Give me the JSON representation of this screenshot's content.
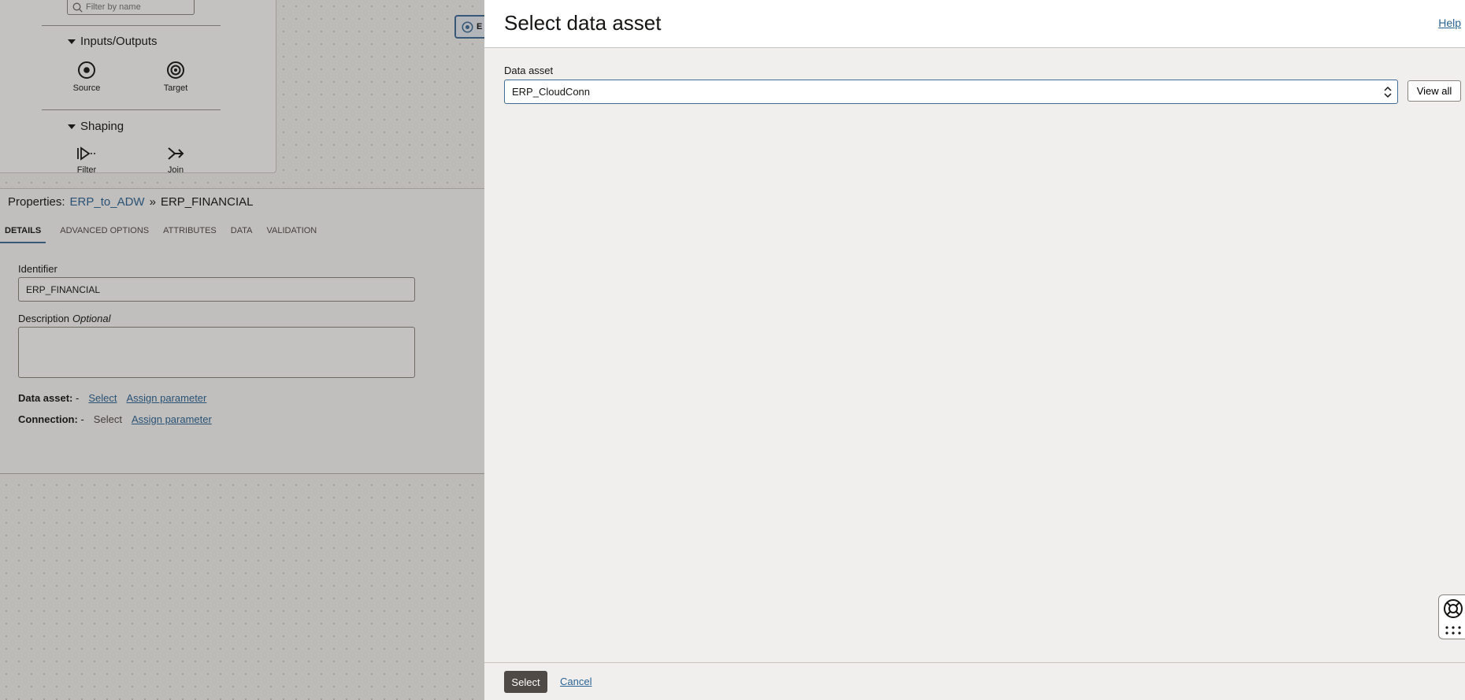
{
  "palette": {
    "filter_placeholder": "Filter by name",
    "sections": [
      {
        "label": "Inputs/Outputs",
        "items": [
          "Source",
          "Target"
        ]
      },
      {
        "label": "Shaping",
        "items": [
          "Filter",
          "Join"
        ]
      }
    ]
  },
  "canvas": {
    "node_label": "E"
  },
  "properties": {
    "prefix": "Properties:",
    "link": "ERP_to_ADW",
    "separator": "»",
    "current": "ERP_FINANCIAL",
    "tabs": [
      "DETAILS",
      "ADVANCED OPTIONS",
      "ATTRIBUTES",
      "DATA",
      "VALIDATION"
    ],
    "identifier_label": "Identifier",
    "identifier_value": "ERP_FINANCIAL",
    "description_label": "Description",
    "description_optional": "Optional",
    "data_asset_label": "Data asset:",
    "data_asset_value": "-",
    "connection_label": "Connection:",
    "connection_value": "-",
    "select_link": "Select",
    "select_text": "Select",
    "assign_parameter": "Assign parameter"
  },
  "drawer": {
    "title": "Select data asset",
    "help": "Help",
    "field_label": "Data asset",
    "selected_value": "ERP_CloudConn",
    "view_all": "View all",
    "select_button": "Select",
    "cancel": "Cancel"
  },
  "colors": {
    "accent": "#3f6c9a",
    "link": "#2a6496",
    "primary_button": "#4f4a45"
  }
}
